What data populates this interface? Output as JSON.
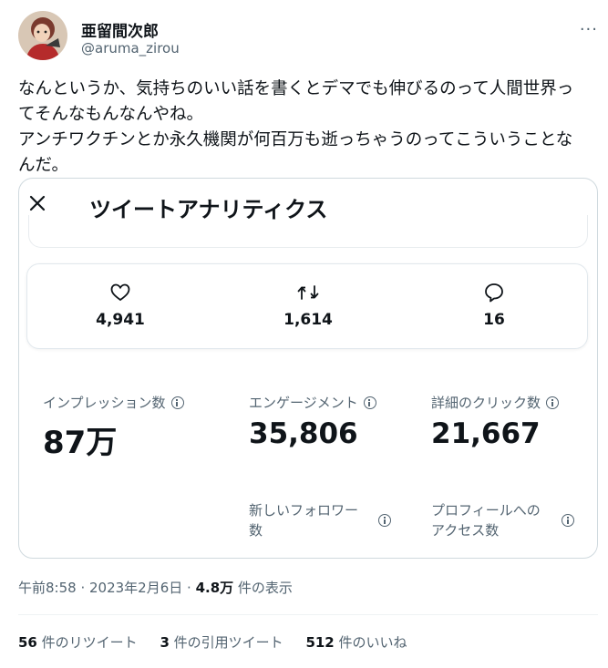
{
  "author": {
    "display_name": "亜留間次郎",
    "handle": "@aruma_zirou",
    "more_label": "···"
  },
  "tweet": {
    "lines": [
      "なんというか、気持ちのいい話を書くとデマでも伸びるのって人間世界っ",
      "てそんなもんなんやね。",
      "アンチワクチンとか永久機関が何百万も逝っちゃうのってこういうことな",
      "んだ。"
    ]
  },
  "analytics": {
    "title": "ツイートアナリティクス",
    "likes": "4,941",
    "retweets": "1,614",
    "replies": "16",
    "impressions_label": "インプレッション数",
    "impressions_value": "87万",
    "engagements_label": "エンゲージメント",
    "engagements_value": "35,806",
    "detail_clicks_label": "詳細のクリック数",
    "detail_clicks_value": "21,667",
    "new_followers_label_1": "新しいフォロワー",
    "new_followers_label_2": "数",
    "profile_visits_label_1": "プロフィールへの",
    "profile_visits_label_2": "アクセス数"
  },
  "meta": {
    "time": "午前8:58",
    "sep1": " · ",
    "date": "2023年2月6日",
    "sep2": " · ",
    "views_value": "4.8万",
    "views_label": " 件の表示"
  },
  "counts": {
    "retweets_value": "56",
    "retweets_label": " 件のリツイート",
    "quotes_value": "3",
    "quotes_label": " 件の引用ツイート",
    "likes_value": "512",
    "likes_label": " 件のいいね"
  },
  "colors": {
    "text": "#0f1419",
    "secondary": "#536471",
    "border": "#cfd9de"
  },
  "icons": {
    "avatar": "avatar-illustration",
    "close": "close-icon",
    "like": "heart-icon",
    "retweet": "retweet-icon",
    "reply": "reply-bubble-icon",
    "info": "info-icon"
  }
}
